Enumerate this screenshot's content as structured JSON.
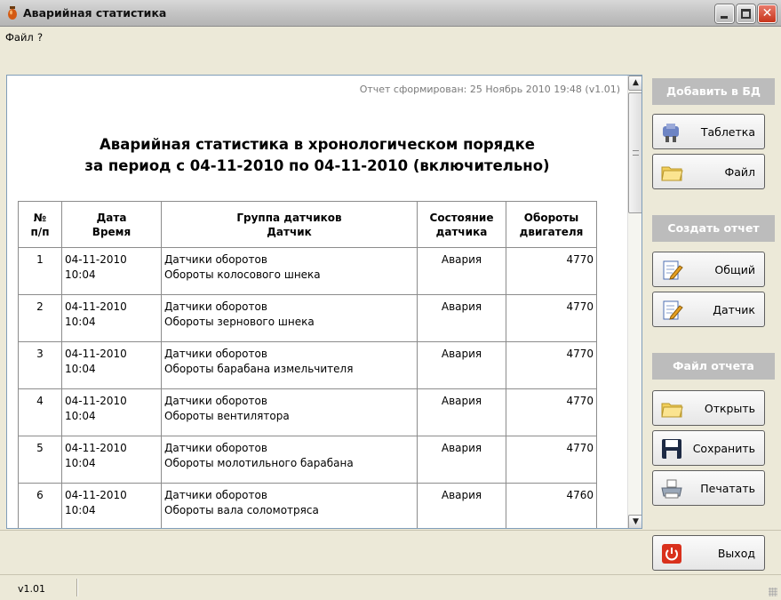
{
  "window": {
    "title": "Аварийная статистика"
  },
  "menu": [
    "Файл",
    "?"
  ],
  "report": {
    "meta": "Отчет сформирован: 25 Ноябрь 2010 19:48 (v1.01)",
    "title_line1": "Аварийная статистика в хронологическом порядке",
    "title_line2": "за период с 04-11-2010 по 04-11-2010 (включительно)",
    "columns": [
      [
        "№",
        "п/п"
      ],
      [
        "Дата",
        "Время"
      ],
      [
        "Группа датчиков",
        "Датчик"
      ],
      [
        "Состояние",
        "датчика"
      ],
      [
        "Обороты",
        "двигателя"
      ]
    ],
    "rows": [
      {
        "num": "1",
        "date": "04-11-2010",
        "time": "10:04",
        "group": "Датчики оборотов",
        "sensor": "Обороты колосового шнека",
        "state": "Авария",
        "rpm": "4770"
      },
      {
        "num": "2",
        "date": "04-11-2010",
        "time": "10:04",
        "group": "Датчики оборотов",
        "sensor": "Обороты зернового шнека",
        "state": "Авария",
        "rpm": "4770"
      },
      {
        "num": "3",
        "date": "04-11-2010",
        "time": "10:04",
        "group": "Датчики оборотов",
        "sensor": "Обороты барабана измельчителя",
        "state": "Авария",
        "rpm": "4770"
      },
      {
        "num": "4",
        "date": "04-11-2010",
        "time": "10:04",
        "group": "Датчики оборотов",
        "sensor": "Обороты вентилятора",
        "state": "Авария",
        "rpm": "4770"
      },
      {
        "num": "5",
        "date": "04-11-2010",
        "time": "10:04",
        "group": "Датчики оборотов",
        "sensor": "Обороты молотильного барабана",
        "state": "Авария",
        "rpm": "4770"
      },
      {
        "num": "6",
        "date": "04-11-2010",
        "time": "10:04",
        "group": "Датчики оборотов",
        "sensor": "Обороты вала соломотряса",
        "state": "Авария",
        "rpm": "4760"
      }
    ]
  },
  "sidebar": {
    "add_db": {
      "header": "Добавить в БД",
      "tablet": "Таблетка",
      "file": "Файл"
    },
    "create_report": {
      "header": "Создать отчет",
      "general": "Общий",
      "sensor": "Датчик"
    },
    "report_file": {
      "header": "Файл отчета",
      "open": "Открыть",
      "save": "Сохранить",
      "print": "Печатать"
    },
    "exit": "Выход"
  },
  "status": {
    "version": "v1.01"
  }
}
